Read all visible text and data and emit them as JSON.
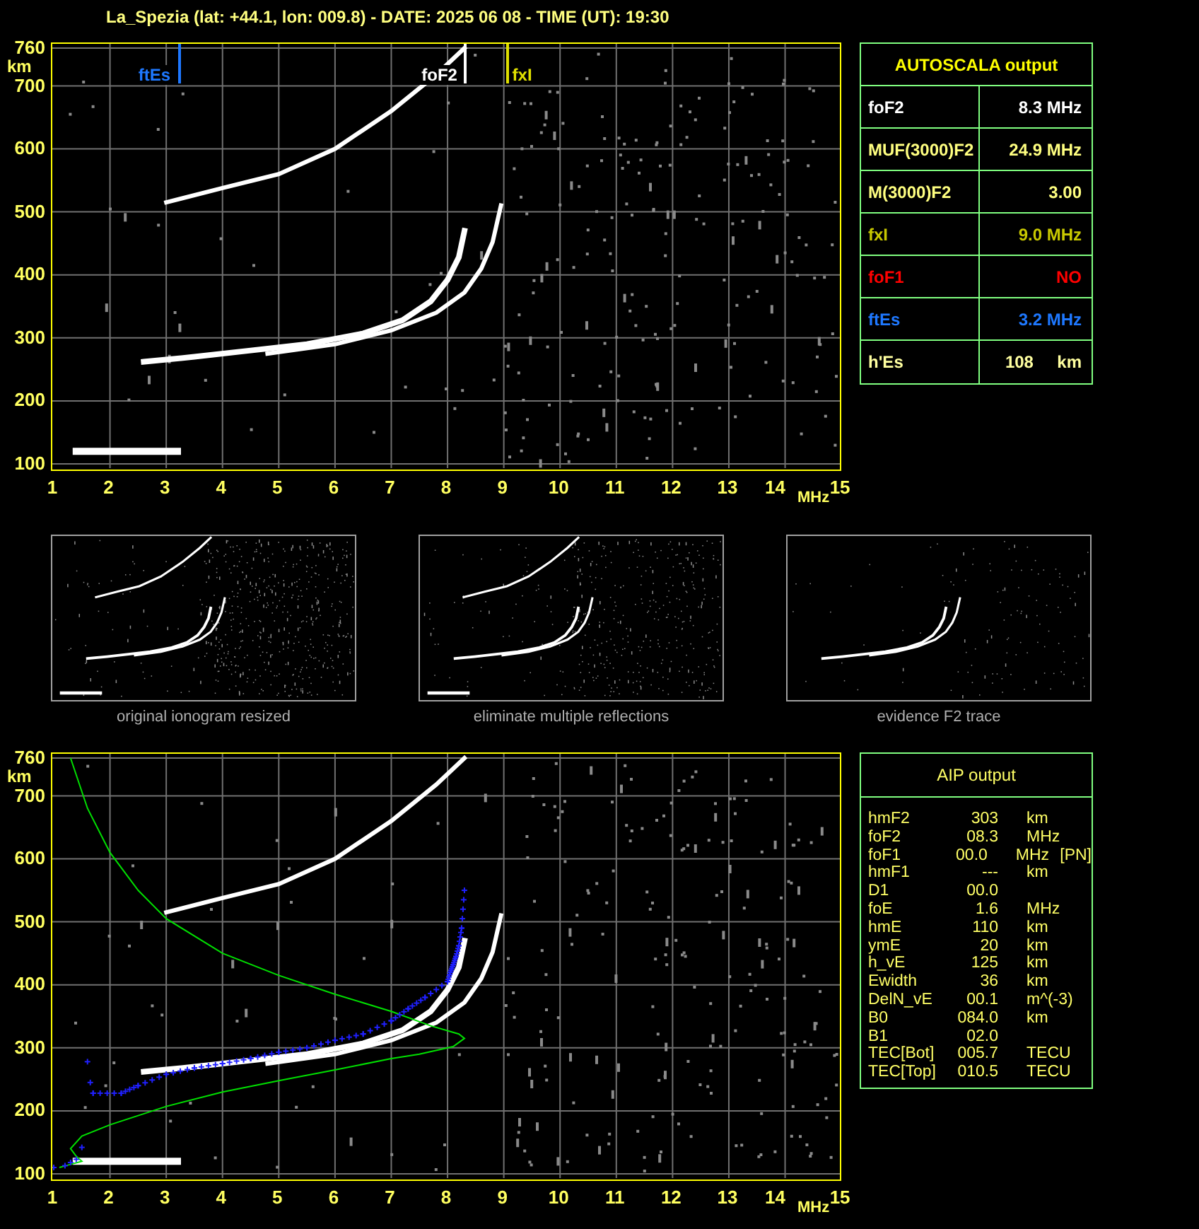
{
  "title": "La_Spezia (lat: +44.1, lon: 009.8) - DATE: 2025 06 08 - TIME (UT): 19:30",
  "top_plot": {
    "y_unit": "km",
    "y_labels": [
      "760",
      "700",
      "600",
      "500",
      "400",
      "300",
      "200",
      "100"
    ],
    "x_labels": [
      "1",
      "2",
      "3",
      "4",
      "5",
      "6",
      "7",
      "8",
      "9",
      "10",
      "11",
      "12",
      "13",
      "14",
      "15"
    ],
    "x_unit": "MHz",
    "markers": [
      {
        "label": "ftEs",
        "color": "#1e78ff"
      },
      {
        "label": "foF2",
        "color": "#ffffff"
      },
      {
        "label": "fxI",
        "color": "#e0e000"
      }
    ]
  },
  "autoscala": {
    "title": "AUTOSCALA output",
    "rows": [
      {
        "label": "foF2",
        "value": "8.3 MHz",
        "color": "#ffffff"
      },
      {
        "label": "MUF(3000)F2",
        "value": "24.9 MHz",
        "color": "#ffff80"
      },
      {
        "label": "M(3000)F2",
        "value": "3.00",
        "color": "#ffff80"
      },
      {
        "label": "fxI",
        "value": "9.0 MHz",
        "color": "#c8c800"
      },
      {
        "label": "foF1",
        "value": "NO",
        "color": "#ff0000"
      },
      {
        "label": "ftEs",
        "value": "3.2 MHz",
        "color": "#1e78ff"
      },
      {
        "label": "h'Es",
        "value": "108     km",
        "color": "#ffffa0"
      }
    ]
  },
  "thumbnails": [
    {
      "caption": "original ionogram resized"
    },
    {
      "caption": "eliminate multiple reflections"
    },
    {
      "caption": "evidence F2 trace"
    }
  ],
  "bottom_plot": {
    "y_unit": "km",
    "y_labels": [
      "760",
      "700",
      "600",
      "500",
      "400",
      "300",
      "200",
      "100"
    ],
    "x_labels": [
      "1",
      "2",
      "3",
      "4",
      "5",
      "6",
      "7",
      "8",
      "9",
      "10",
      "11",
      "12",
      "13",
      "14",
      "15"
    ],
    "x_unit": "MHz"
  },
  "aip": {
    "title": "AIP output",
    "rows": [
      {
        "name": "hmF2",
        "value": "303",
        "unit": "km"
      },
      {
        "name": "foF2",
        "value": "08.3",
        "unit": "MHz"
      },
      {
        "name": "foF1",
        "value": "00.0",
        "unit": "MHz",
        "note": "[PN]"
      },
      {
        "name": "hmF1",
        "value": "---",
        "unit": "km"
      },
      {
        "name": "D1",
        "value": "00.0"
      },
      {
        "name": "foE",
        "value": "1.6",
        "unit": "MHz"
      },
      {
        "name": "hmE",
        "value": "110",
        "unit": "km"
      },
      {
        "name": "ymE",
        "value": "20",
        "unit": "km"
      },
      {
        "name": "h_vE",
        "value": "125",
        "unit": "km"
      },
      {
        "name": "Ewidth",
        "value": "36",
        "unit": "km"
      },
      {
        "name": "DelN_vE",
        "value": "00.1",
        "unit": "m^(-3)"
      },
      {
        "name": "B0",
        "value": "084.0",
        "unit": "km"
      },
      {
        "name": "B1",
        "value": "02.0"
      },
      {
        "name": "TEC[Bot]",
        "value": "005.7",
        "unit": "TECU"
      },
      {
        "name": "TEC[Top]",
        "value": "010.5",
        "unit": "TECU"
      }
    ]
  }
}
